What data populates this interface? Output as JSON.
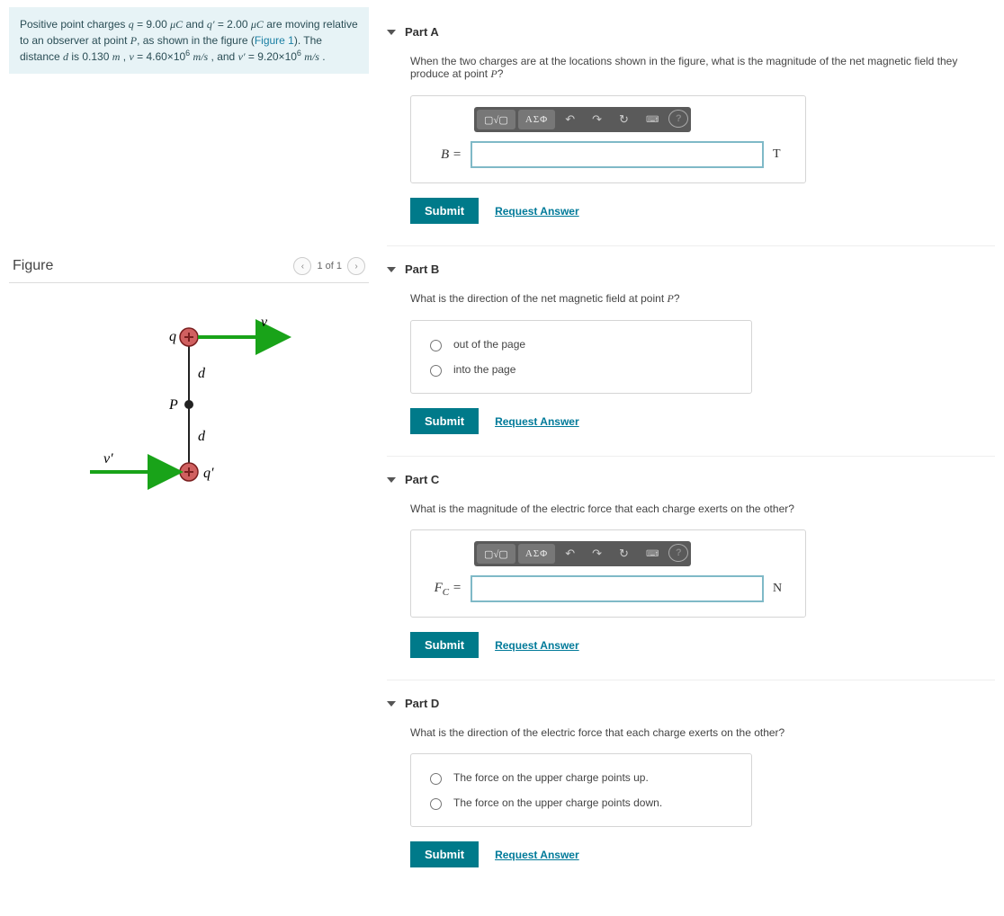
{
  "problem": {
    "q_val": "9.00",
    "q_unit": "μC",
    "qprime_val": "2.00",
    "qprime_unit": "μC",
    "d_val": "0.130",
    "d_unit": "m",
    "v_val": "4.60×10",
    "v_exp": "6",
    "v_unit": "m/s",
    "vprime_val": "9.20×10",
    "vprime_exp": "6",
    "vprime_unit": "m/s",
    "figure_link": "Figure 1"
  },
  "figure": {
    "heading": "Figure",
    "pager": "1 of 1",
    "labels": {
      "v": "v",
      "vprime": "v′",
      "q": "q",
      "qprime": "q′",
      "d": "d",
      "P": "P"
    }
  },
  "parts": {
    "A": {
      "title": "Part A",
      "prompt_pre": "When the two charges are at the locations shown in the figure, what is the magnitude of the net magnetic field they produce at point ",
      "prompt_var": "P",
      "prompt_post": "?",
      "var_label": "B =",
      "unit": "T"
    },
    "B": {
      "title": "Part B",
      "prompt_pre": "What is the direction of the net magnetic field at point ",
      "prompt_var": "P",
      "prompt_post": "?",
      "options": [
        "out of the page",
        "into the page"
      ]
    },
    "C": {
      "title": "Part C",
      "prompt": "What is the magnitude of the electric force that each charge exerts on the other?",
      "var_html": "F",
      "var_sub": "C",
      "var_eq": " =",
      "unit": "N"
    },
    "D": {
      "title": "Part D",
      "prompt": "What is the direction of the electric force that each charge exerts on the other?",
      "options": [
        "The force on the upper charge points up.",
        "The force on the upper charge points down."
      ]
    }
  },
  "toolbar": {
    "templates": "▢√▢",
    "greek": "ΑΣΦ",
    "undo": "↶",
    "redo": "↷",
    "reset": "↻",
    "keyboard": "⌨",
    "help": "?"
  },
  "actions": {
    "submit": "Submit",
    "request": "Request Answer"
  }
}
